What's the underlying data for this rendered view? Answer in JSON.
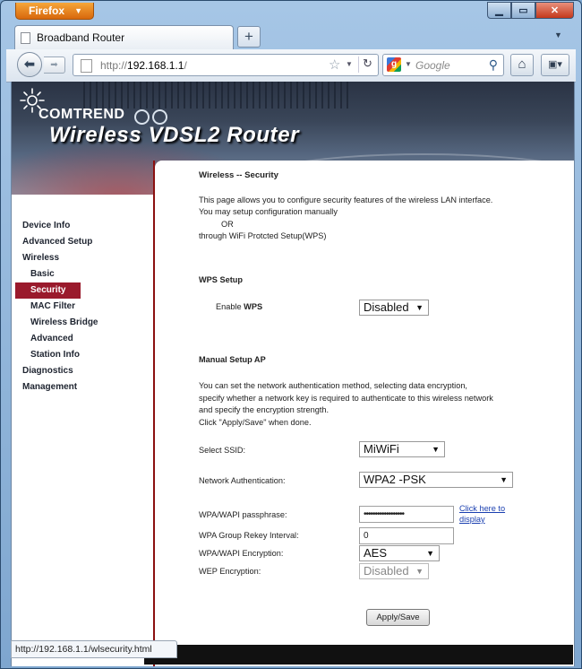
{
  "browser": {
    "app_button": "Firefox",
    "tab_title": "Broadband Router",
    "new_tab": "+",
    "url_prefix": "http://",
    "url_host": "192.168.1.1",
    "url_suffix": "/",
    "search_placeholder": "Google",
    "status_url": "http://192.168.1.1/wlsecurity.html"
  },
  "banner": {
    "brand": "COMTREND",
    "title": "Wireless VDSL2 Router"
  },
  "sidebar": {
    "items": [
      {
        "label": "Device Info"
      },
      {
        "label": "Advanced Setup"
      },
      {
        "label": "Wireless"
      },
      {
        "label": "Basic"
      },
      {
        "label": "Security"
      },
      {
        "label": "MAC Filter"
      },
      {
        "label": "Wireless Bridge"
      },
      {
        "label": "Advanced"
      },
      {
        "label": "Station Info"
      },
      {
        "label": "Diagnostics"
      },
      {
        "label": "Management"
      }
    ]
  },
  "page": {
    "heading": "Wireless -- Security",
    "intro1": "This page allows you to configure security features of the wireless LAN interface.",
    "intro2": "You may setup configuration manually",
    "intro_or": "OR",
    "intro3": "through WiFi Protcted Setup(WPS)",
    "wps_heading": "WPS Setup",
    "wps_label_pre": "Enable ",
    "wps_label_bold": "WPS",
    "wps_value": "Disabled",
    "manual_heading": "Manual Setup AP",
    "manual1": "You can set the network authentication method, selecting data encryption,",
    "manual2": "specify whether a network key is required to authenticate to this wireless network",
    "manual3": "and specify the encryption strength.",
    "manual4": "Click \"Apply/Save\" when done.",
    "ssid_label": "Select SSID:",
    "ssid_value": "MiWiFi",
    "auth_label": "Network Authentication:",
    "auth_value": "WPA2 -PSK",
    "pass_label": "WPA/WAPI passphrase:",
    "pass_value": "••••••••••••••••••",
    "click_here_1": "Click here to",
    "click_here_2": "display",
    "rekey_label": "WPA Group Rekey Interval:",
    "rekey_value": "0",
    "enc_label": "WPA/WAPI Encryption:",
    "enc_value": "AES",
    "wep_label": "WEP Encryption:",
    "wep_value": "Disabled",
    "apply_button": "Apply/Save"
  }
}
